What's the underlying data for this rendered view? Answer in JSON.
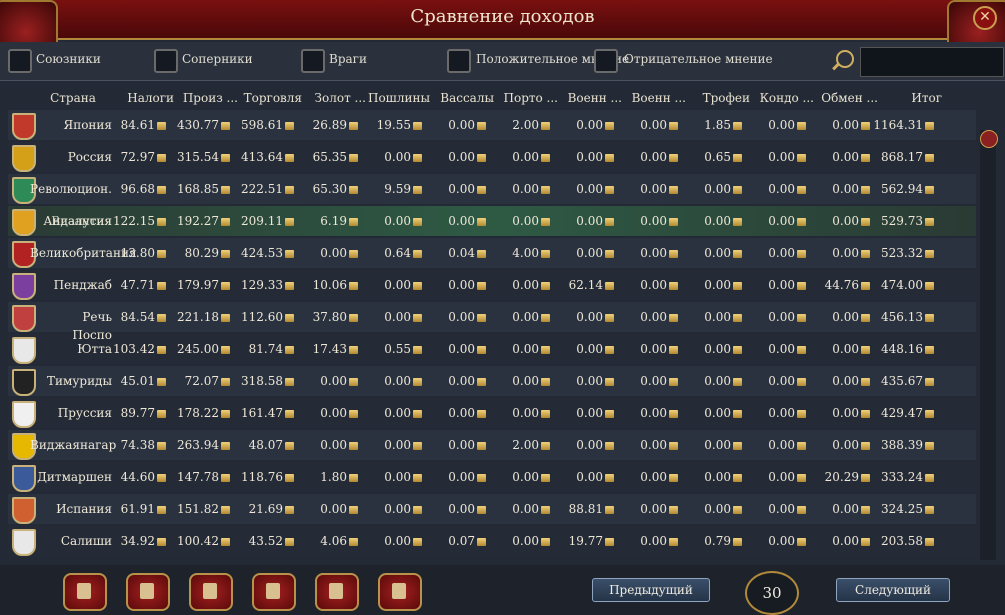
{
  "window": {
    "title": "Сравнение доходов",
    "close_label": "✕"
  },
  "filters": [
    {
      "label": "Союзники",
      "checked": false
    },
    {
      "label": "Соперники",
      "checked": false
    },
    {
      "label": "Враги",
      "checked": false
    },
    {
      "label": "Положительное мнение",
      "checked": false
    },
    {
      "label": "Отрицательное мнение",
      "checked": false
    }
  ],
  "search": {
    "placeholder": ""
  },
  "columns": [
    "Страна",
    "Налоги",
    "Произ ...",
    "Торговля",
    "Золот ...",
    "Пошлины",
    "Вассалы",
    "Порто ...",
    "Военн ...",
    "Военн ...",
    "Трофеи",
    "Кондо ...",
    "Обмен ...",
    "Итог"
  ],
  "rows": [
    {
      "name": "Япония",
      "values": [
        "84.61",
        "430.77",
        "598.61",
        "26.89",
        "19.55",
        "0.00",
        "2.00",
        "0.00",
        "0.00",
        "1.85",
        "0.00",
        "0.00",
        "1164.31"
      ],
      "flag": "#c0392b"
    },
    {
      "name": "Россия",
      "values": [
        "72.97",
        "315.54",
        "413.64",
        "65.35",
        "0.00",
        "0.00",
        "0.00",
        "0.00",
        "0.00",
        "0.65",
        "0.00",
        "0.00",
        "868.17"
      ],
      "flag": "#d4a017"
    },
    {
      "name": "Революцион.",
      "values": [
        "96.68",
        "168.85",
        "222.51",
        "65.30",
        "9.59",
        "0.00",
        "0.00",
        "0.00",
        "0.00",
        "0.00",
        "0.00",
        "0.00",
        "562.94"
      ],
      "flag": "#2e8b57"
    },
    {
      "name": "Андалусия",
      "values": [
        "122.15",
        "192.27",
        "209.11",
        "6.19",
        "0.00",
        "0.00",
        "0.00",
        "0.00",
        "0.00",
        "0.00",
        "0.00",
        "0.00",
        "529.73"
      ],
      "flag": "#e0a020",
      "highlight": true
    },
    {
      "name": "Великобритания",
      "values": [
        "13.80",
        "80.29",
        "424.53",
        "0.00",
        "0.64",
        "0.04",
        "4.00",
        "0.00",
        "0.00",
        "0.00",
        "0.00",
        "0.00",
        "523.32"
      ],
      "flag": "#b22222"
    },
    {
      "name": "Пенджаб",
      "values": [
        "47.71",
        "179.97",
        "129.33",
        "10.06",
        "0.00",
        "0.00",
        "0.00",
        "62.14",
        "0.00",
        "0.00",
        "0.00",
        "44.76",
        "474.00"
      ],
      "flag": "#7b3fa0"
    },
    {
      "name": "Речь",
      "values": [
        "84.54",
        "221.18",
        "112.60",
        "37.80",
        "0.00",
        "0.00",
        "0.00",
        "0.00",
        "0.00",
        "0.00",
        "0.00",
        "0.00",
        "456.13"
      ],
      "flag": "#c04040"
    },
    {
      "name": "Ютта",
      "values": [
        "103.42",
        "245.00",
        "81.74",
        "17.43",
        "0.55",
        "0.00",
        "0.00",
        "0.00",
        "0.00",
        "0.00",
        "0.00",
        "0.00",
        "448.16"
      ],
      "flag": "#e8e8e8"
    },
    {
      "name": "Тимуриды",
      "values": [
        "45.01",
        "72.07",
        "318.58",
        "0.00",
        "0.00",
        "0.00",
        "0.00",
        "0.00",
        "0.00",
        "0.00",
        "0.00",
        "0.00",
        "435.67"
      ],
      "flag": "#222222"
    },
    {
      "name": "Пруссия",
      "values": [
        "89.77",
        "178.22",
        "161.47",
        "0.00",
        "0.00",
        "0.00",
        "0.00",
        "0.00",
        "0.00",
        "0.00",
        "0.00",
        "0.00",
        "429.47"
      ],
      "flag": "#f0f0f0"
    },
    {
      "name": "Виджаянагар",
      "values": [
        "74.38",
        "263.94",
        "48.07",
        "0.00",
        "0.00",
        "0.00",
        "2.00",
        "0.00",
        "0.00",
        "0.00",
        "0.00",
        "0.00",
        "388.39"
      ],
      "flag": "#e6b800"
    },
    {
      "name": "Дитмаршен",
      "values": [
        "44.60",
        "147.78",
        "118.76",
        "1.80",
        "0.00",
        "0.00",
        "0.00",
        "0.00",
        "0.00",
        "0.00",
        "0.00",
        "20.29",
        "333.24"
      ],
      "flag": "#3a5a9a"
    },
    {
      "name": "Испания",
      "values": [
        "61.91",
        "151.82",
        "21.69",
        "0.00",
        "0.00",
        "0.00",
        "0.00",
        "88.81",
        "0.00",
        "0.00",
        "0.00",
        "0.00",
        "324.25"
      ],
      "flag": "#d06030"
    },
    {
      "name": "Салиши",
      "values": [
        "34.92",
        "100.42",
        "43.52",
        "4.06",
        "0.00",
        "0.07",
        "0.00",
        "19.77",
        "0.00",
        "0.79",
        "0.00",
        "0.00",
        "203.58"
      ],
      "flag": "#e8e8e8"
    }
  ],
  "overlap_labels": [
    "Византия",
    "Поспо"
  ],
  "footer": {
    "prev_label": "Предыдущий",
    "next_label": "Следующий",
    "page": "30"
  }
}
